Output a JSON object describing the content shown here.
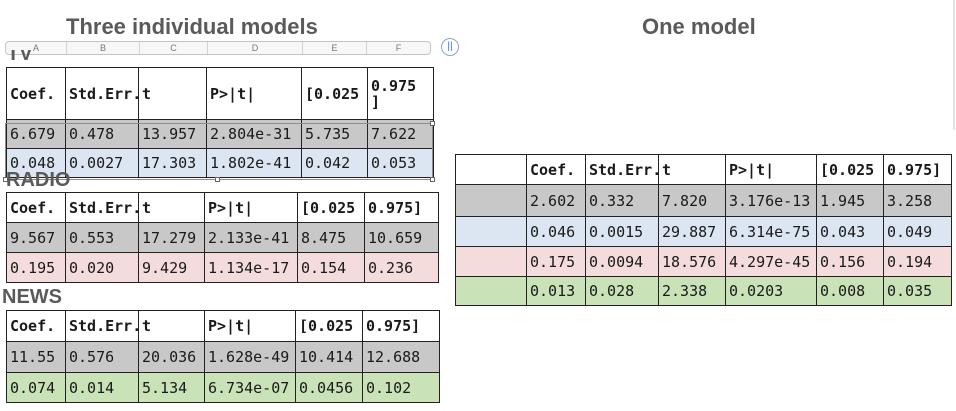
{
  "headings": {
    "left": "Three individual models",
    "right": "One model"
  },
  "column_letters": [
    "A",
    "B",
    "C",
    "D",
    "E",
    "F"
  ],
  "freeze_button": "||",
  "tables": {
    "tv": {
      "label": "TV",
      "header": [
        "Coef.",
        "Std.Err.",
        "t",
        "P>|t|",
        "[0.025",
        "0.975\n]"
      ],
      "rows": [
        {
          "style": "gray",
          "cells": [
            "6.679",
            "0.478",
            "13.957",
            "2.804e-31",
            "5.735",
            "7.622"
          ]
        },
        {
          "style": "blue",
          "cells": [
            "0.048",
            "0.0027",
            "17.303",
            "1.802e-41",
            "0.042",
            "0.053"
          ]
        }
      ]
    },
    "radio": {
      "label": "RADIO",
      "header": [
        "Coef.",
        "Std.Err.",
        "t",
        "P>|t|",
        "[0.025",
        "0.975]"
      ],
      "rows": [
        {
          "style": "gray",
          "cells": [
            "9.567",
            "0.553",
            "17.279",
            "2.133e-41",
            "8.475",
            "10.659"
          ]
        },
        {
          "style": "pink",
          "cells": [
            "0.195",
            "0.020",
            "9.429",
            "1.134e-17",
            "0.154",
            "0.236"
          ]
        }
      ]
    },
    "news": {
      "label": "NEWS",
      "header": [
        "Coef.",
        "Std.Err.",
        "t",
        "P>|t|",
        "[0.025",
        "0.975]"
      ],
      "rows": [
        {
          "style": "gray",
          "cells": [
            "11.55",
            "0.576",
            "20.036",
            "1.628e-49",
            "10.414",
            "12.688"
          ]
        },
        {
          "style": "green",
          "cells": [
            "0.074",
            "0.014",
            "5.134",
            "6.734e-07",
            "0.0456",
            "0.102"
          ]
        }
      ]
    },
    "combined": {
      "header": [
        "",
        "Coef.",
        "Std.Err.",
        "t",
        "P>|t|",
        "[0.025",
        "0.975]"
      ],
      "rows": [
        {
          "style": "gray",
          "cells": [
            "",
            "2.602",
            "0.332",
            "7.820",
            "3.176e-13",
            "1.945",
            "3.258"
          ]
        },
        {
          "style": "blue",
          "cells": [
            "",
            "0.046",
            "0.0015",
            "29.887",
            "6.314e-75",
            "0.043",
            "0.049"
          ]
        },
        {
          "style": "pink",
          "cells": [
            "",
            "0.175",
            "0.0094",
            "18.576",
            "4.297e-45",
            "0.156",
            "0.194"
          ]
        },
        {
          "style": "green",
          "cells": [
            "",
            "0.013",
            "0.028",
            "2.338",
            "0.0203",
            "0.008",
            "0.035"
          ]
        }
      ]
    }
  }
}
